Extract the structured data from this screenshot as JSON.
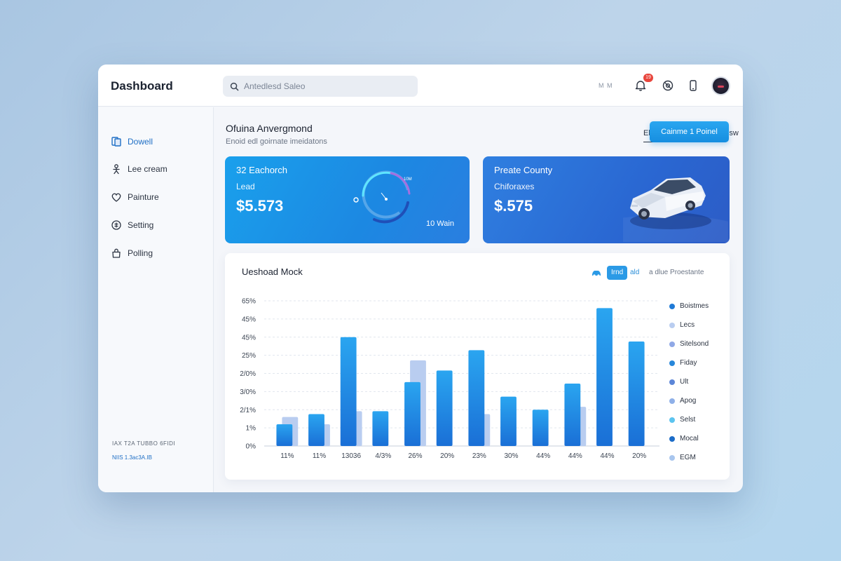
{
  "header": {
    "title": "Dashboard",
    "search_placeholder": "Antedlesd Saleo",
    "small_text": "M M",
    "notification_count": "19"
  },
  "sidebar": {
    "items": [
      {
        "label": "Dowell",
        "icon": "document-icon",
        "active": true
      },
      {
        "label": "Lee cream",
        "icon": "person-icon",
        "active": false
      },
      {
        "label": "Painture",
        "icon": "heart-icon",
        "active": false
      },
      {
        "label": "Setting",
        "icon": "gear-icon",
        "active": false
      },
      {
        "label": "Polling",
        "icon": "bag-icon",
        "active": false
      }
    ],
    "footer_line1": "IAX T2A TUBBO 6FIDI",
    "footer_line2": "NIIS 1.3ac3A.IB"
  },
  "main": {
    "title": "Ofuina Anvergmond",
    "subtitle": "Enoid edl goirnate imeidatons",
    "tabs": [
      {
        "label": "Ebeoctice",
        "active": true
      },
      {
        "label": "CRU Soulisw",
        "active": false
      }
    ],
    "primary_button": "Cainme 1 Poinel"
  },
  "cards": [
    {
      "title": "32 Eachorch",
      "subtitle": "Lead",
      "value": "$5.573",
      "footer": "10 Wain",
      "gauge_label": "10M"
    },
    {
      "title": "Preate County",
      "subtitle": "Chiforaxes",
      "value": "$.575"
    }
  ],
  "chart_panel": {
    "title": "Ueshoad Mock",
    "control_pill": "Irnd",
    "control_tag": "ald",
    "control_text": "a dlue Proestante"
  },
  "chart_data": {
    "type": "bar",
    "categories": [
      "11%",
      "11%",
      "13036",
      "4/3%",
      "26%",
      "20%",
      "23%",
      "30%",
      "44%",
      "44%",
      "44%",
      "20%"
    ],
    "y_tick_labels": [
      "0%",
      "1%",
      "2/1%",
      "3/0%",
      "2/0%",
      "25%",
      "45%",
      "45%",
      "65%"
    ],
    "series": [
      {
        "values": [
          15,
          22,
          75,
          24,
          44,
          52,
          66,
          34,
          25,
          43,
          95,
          72
        ]
      },
      {
        "values": [
          20,
          15,
          24,
          0,
          59,
          0,
          22,
          0,
          0,
          27,
          0,
          0
        ]
      }
    ],
    "ylim": [
      0,
      100
    ],
    "grid": true,
    "legend": {
      "position": "right",
      "entries": [
        {
          "label": "Boistmes",
          "color": "#1f7ad6"
        },
        {
          "label": "Lecs",
          "color": "#b9cdf0"
        },
        {
          "label": "Sitelsond",
          "color": "#8fa8e6"
        },
        {
          "label": "Fiday",
          "color": "#2787da"
        },
        {
          "label": "Ult",
          "color": "#5c86d8"
        },
        {
          "label": "Apog",
          "color": "#8fb0e8"
        },
        {
          "label": "Selst",
          "color": "#5cc4ef"
        },
        {
          "label": "Mocal",
          "color": "#1c6cc8"
        },
        {
          "label": "EGM",
          "color": "#a9c6ee"
        }
      ]
    }
  },
  "colors": {
    "accent": "#1f8fe3",
    "card1": "#1c94e8",
    "card2": "#2c6ad4",
    "bar_primary": "#1f86e0",
    "bar_secondary": "#b9cdf0"
  }
}
